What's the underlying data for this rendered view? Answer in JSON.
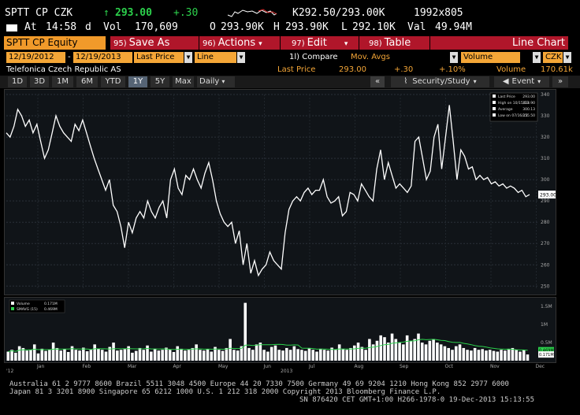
{
  "quote": {
    "ticker": "SPTT CP CZK",
    "arrow": "↑",
    "last": "293.00",
    "change": "+.30",
    "bid_prefix": "K",
    "bid_ask": "292.50/293.00",
    "ask_suffix": "K",
    "size": "1992",
    "size_sep": "x",
    "size2": "805",
    "at_label": "At",
    "time": "14:58",
    "time_suffix": "d",
    "vol_label": "Vol",
    "volume": "170,609",
    "open_label": "O",
    "open": "293.90K",
    "high_label": "H",
    "high": "293.90K",
    "low_label": "L",
    "low": "292.10K",
    "val_label": "Val",
    "value": "49.94M"
  },
  "funcbar": {
    "security": "SPTT CP Equity",
    "save": {
      "num": "95)",
      "label": "Save As"
    },
    "actions": {
      "num": "96)",
      "label": "Actions"
    },
    "edit": {
      "num": "97)",
      "label": "Edit"
    },
    "table": {
      "num": "98)",
      "label": "Table"
    },
    "view": "Line Chart"
  },
  "fields": {
    "start_date": "12/19/2012",
    "dash": "-",
    "end_date": "12/19/2013",
    "price_type": "Last Price",
    "chart_type": "Line",
    "compare": "1l) Compare",
    "mov_avgs": "Mov. Avgs",
    "volume_field": "Volume",
    "currency": "CZK"
  },
  "info": {
    "name": "Telefonica Czech Republic AS",
    "last_price_label": "Last Price",
    "last_price": "293.00",
    "change": "+.30",
    "pct": "+.10%",
    "volume_label": "Volume",
    "volume": "170.61k"
  },
  "toolbar": {
    "periods": [
      "1D",
      "3D",
      "1M",
      "6M",
      "YTD",
      "1Y",
      "5Y",
      "Max"
    ],
    "selected": "1Y",
    "frequency": "Daily",
    "collapse": "«",
    "security_study": "Security/Study",
    "event": "Event",
    "chevron": "»"
  },
  "chart_data": [
    {
      "type": "line",
      "series": [
        {
          "name": "Last Price",
          "values": [
            322,
            320,
            325,
            333,
            330,
            325,
            328,
            322,
            326,
            318,
            310,
            314,
            322,
            330,
            325,
            322,
            320,
            318,
            326,
            323,
            328,
            322,
            316,
            310,
            305,
            300,
            295,
            300,
            288,
            285,
            278,
            268,
            280,
            275,
            282,
            285,
            282,
            290,
            285,
            282,
            287,
            290,
            282,
            300,
            305,
            296,
            293,
            302,
            300,
            305,
            300,
            296,
            303,
            308,
            300,
            290,
            284,
            280,
            278,
            280,
            270,
            276,
            260,
            270,
            256,
            262,
            255,
            258,
            260,
            266,
            262,
            260,
            258,
            275,
            286,
            290,
            292,
            290,
            294,
            296,
            293,
            295,
            295,
            300,
            292,
            289,
            290,
            292,
            283,
            285,
            294,
            293,
            290,
            298,
            295,
            292,
            290,
            305,
            314,
            300,
            308,
            302,
            296,
            298,
            296,
            294,
            297,
            318,
            320,
            310,
            300,
            304,
            320,
            326,
            305,
            320,
            335,
            318,
            300,
            314,
            311,
            305,
            306,
            300,
            302,
            300,
            301,
            298,
            299,
            297,
            298,
            296,
            297,
            296,
            294,
            295,
            292,
            293
          ]
        }
      ],
      "ylim": [
        249,
        340
      ],
      "yticks": [
        250,
        260,
        270,
        280,
        290,
        300,
        310,
        320,
        330,
        340
      ],
      "xticks": [
        "Jan",
        "Feb",
        "Mar",
        "Apr",
        "May",
        "Jun",
        "Jul",
        "Aug",
        "Sep",
        "Oct",
        "Nov",
        "Dec"
      ],
      "x_year_labels": [
        "'12",
        "2013"
      ],
      "last_tag": "293.00",
      "legend": [
        {
          "label": "Last Price",
          "value": "293.00"
        },
        {
          "label": "High on 10/15/13",
          "value": "333.90"
        },
        {
          "label": "Average",
          "value": "300.13"
        },
        {
          "label": "Low on 07/16/13",
          "value": "255.50"
        }
      ]
    },
    {
      "type": "bar",
      "series": [
        {
          "name": "Volume",
          "value_label": "0.171M",
          "values": [
            0.25,
            0.3,
            0.22,
            0.4,
            0.35,
            0.28,
            0.3,
            0.45,
            0.2,
            0.33,
            0.27,
            0.3,
            0.5,
            0.35,
            0.28,
            0.32,
            0.24,
            0.4,
            0.3,
            0.28,
            0.36,
            0.26,
            0.3,
            0.45,
            0.33,
            0.3,
            0.25,
            0.38,
            0.5,
            0.28,
            0.3,
            0.32,
            0.4,
            0.22,
            0.27,
            0.35,
            0.3,
            0.42,
            0.25,
            0.33,
            0.28,
            0.3,
            0.36,
            0.3,
            0.24,
            0.4,
            0.33,
            0.28,
            0.3,
            0.35,
            0.45,
            0.3,
            0.28,
            0.32,
            0.25,
            0.38,
            0.3,
            0.27,
            0.35,
            0.6,
            0.3,
            0.28,
            0.4,
            1.6,
            0.35,
            0.3,
            0.45,
            0.5,
            0.3,
            0.25,
            0.38,
            0.42,
            0.3,
            0.28,
            0.35,
            0.3,
            0.4,
            0.32,
            0.3,
            0.27,
            0.35,
            0.3,
            0.25,
            0.33,
            0.3,
            0.28,
            0.36,
            0.3,
            0.45,
            0.33,
            0.3,
            0.35,
            0.42,
            0.5,
            0.38,
            0.3,
            0.6,
            0.45,
            0.55,
            0.7,
            0.65,
            0.5,
            0.75,
            0.6,
            0.5,
            0.45,
            0.7,
            0.55,
            0.6,
            0.75,
            0.5,
            0.45,
            0.55,
            0.6,
            0.5,
            0.45,
            0.4,
            0.35,
            0.3,
            0.4,
            0.45,
            0.35,
            0.3,
            0.28,
            0.35,
            0.3,
            0.32,
            0.28,
            0.3,
            0.27,
            0.25,
            0.3,
            0.28,
            0.33,
            0.35,
            0.3,
            0.25,
            0.3,
            0.171
          ]
        },
        {
          "name": "SMAVG (15)",
          "value_label": "0.469M"
        }
      ],
      "yticks": [
        "0.5M",
        "1M",
        "1.5M"
      ],
      "ylim": [
        0,
        1.7
      ]
    }
  ],
  "footer": {
    "line1": "Australia 61 2 9777 8600 Brazil 5511 3048 4500 Europe 44 20 7330 7500 Germany 49 69 9204 1210 Hong Kong 852 2977 6000",
    "line2": "Japan 81 3 3201 8900          Singapore 65 6212 1000          U.S. 1 212 318 2000         Copyright 2013 Bloomberg Finance L.P.",
    "line3": "SN 876420 CET  GMT+1:00 H266-1978-0 19-Dec-2013 15:13:55"
  }
}
